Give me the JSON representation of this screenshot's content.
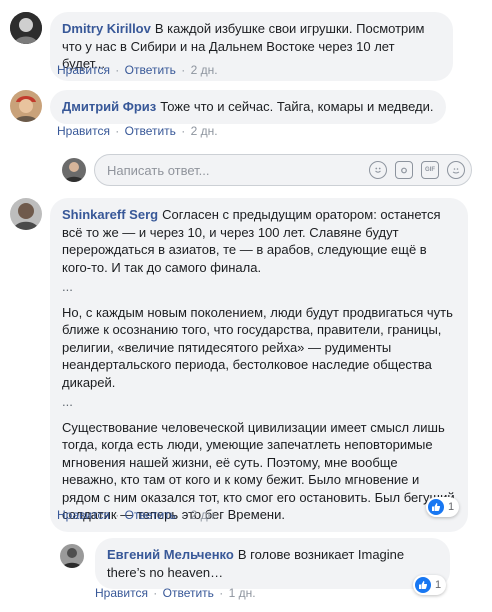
{
  "comments": [
    {
      "author": "Dmitry Kirillov",
      "text": "В каждой избушке свои игрушки. Посмотрим что у нас в Сибири и на Дальнем Востоке через 10 лет будет...",
      "like": "Нравится",
      "reply": "Ответить",
      "time": "2 дн."
    },
    {
      "author": "Дмитрий Фриз",
      "text": "Тоже что и сейчас. Тайга, комары и медведи.",
      "like": "Нравится",
      "reply": "Ответить",
      "time": "2 дн."
    },
    {
      "author": "Shinkareff Serg",
      "text_p1": "Согласен с предыдущим оратором: останется всё то же — и через 10, и через 100 лет. Славяне будут перерождаться в азиатов, те — в арабов, следующие ещё в кого-то. И так до самого финала.",
      "ellipsis1": "...",
      "text_p2": "Но, с каждым новым поколением, люди будут продвигаться чуть ближе к осознанию того, что государства, правители, границы, религии, «величие пятидесятого рейха» — рудименты неандертальского периода, бестолковое наследие общества дикарей.",
      "ellipsis2": "...",
      "text_p3": "Существование человеческой цивилизации имеет смысл лишь тогда, когда есть люди, умеющие запечатлеть неповторимые мгновения нашей жизни, её суть. Поэтому, мне вообще неважно, кто там от кого и к кому бежит. Было мгновение и рядом с ним оказался тот, кто смог его остановить. Был бегущий солдатик — теперь это бег Времени.",
      "like": "Нравится",
      "reply": "Ответить",
      "time": "2 дн.",
      "like_count": "1"
    },
    {
      "author": "Евгений Мельченко",
      "text": "В голове возникает Imagine there’s no heaven…",
      "like": "Нравится",
      "reply": "Ответить",
      "time": "1 дн.",
      "like_count": "1"
    }
  ],
  "reply_box": {
    "placeholder": "Написать ответ...",
    "icons": [
      "emoji-icon",
      "camera-icon",
      "gif-icon",
      "sticker-icon"
    ],
    "gif_label": "GIF"
  },
  "separator": "·",
  "colors": {
    "link": "#385898",
    "bubble": "#f2f3f5",
    "meta": "#8d949e",
    "like_badge": "#1877f2"
  }
}
